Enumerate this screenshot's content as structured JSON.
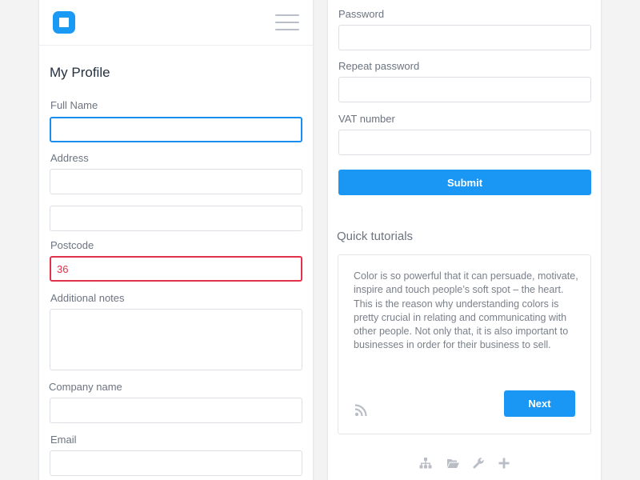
{
  "header": {
    "logo": "app-logo-icon",
    "menu_icon": "hamburger-menu-icon"
  },
  "profile": {
    "title": "My Profile",
    "full_name_label": "Full Name",
    "full_name_value": "",
    "address_label": "Address",
    "address_line1_value": "",
    "address_line2_value": "",
    "postcode_label": "Postcode",
    "postcode_value": "36",
    "notes_label": "Additional notes",
    "notes_value": "",
    "company_label": "Company name",
    "company_value": "",
    "email_label": "Email",
    "email_value": ""
  },
  "account": {
    "password_label": "Password",
    "repeat_password_label": "Repeat password",
    "vat_label": "VAT number",
    "vat_value": "",
    "submit_label": "Submit"
  },
  "tutorials": {
    "title": "Quick tutorials",
    "card_text": "Color is so powerful that it can persuade, motivate, inspire and touch people’s soft spot – the heart. This is the reason why understanding colors is pretty crucial in relating and communicating with other people. Not only that, it is also important to businesses in order for their business to sell.",
    "feed_icon": "rss-icon",
    "next_label": "Next"
  },
  "footer": {
    "icons": [
      "sitemap-icon",
      "folder-open-icon",
      "wrench-icon",
      "plus-icon"
    ]
  },
  "colors": {
    "accent": "#1a96f5",
    "focus_border": "#1a8ef0",
    "error": "#e0324a",
    "background": "#f3f3f4"
  }
}
